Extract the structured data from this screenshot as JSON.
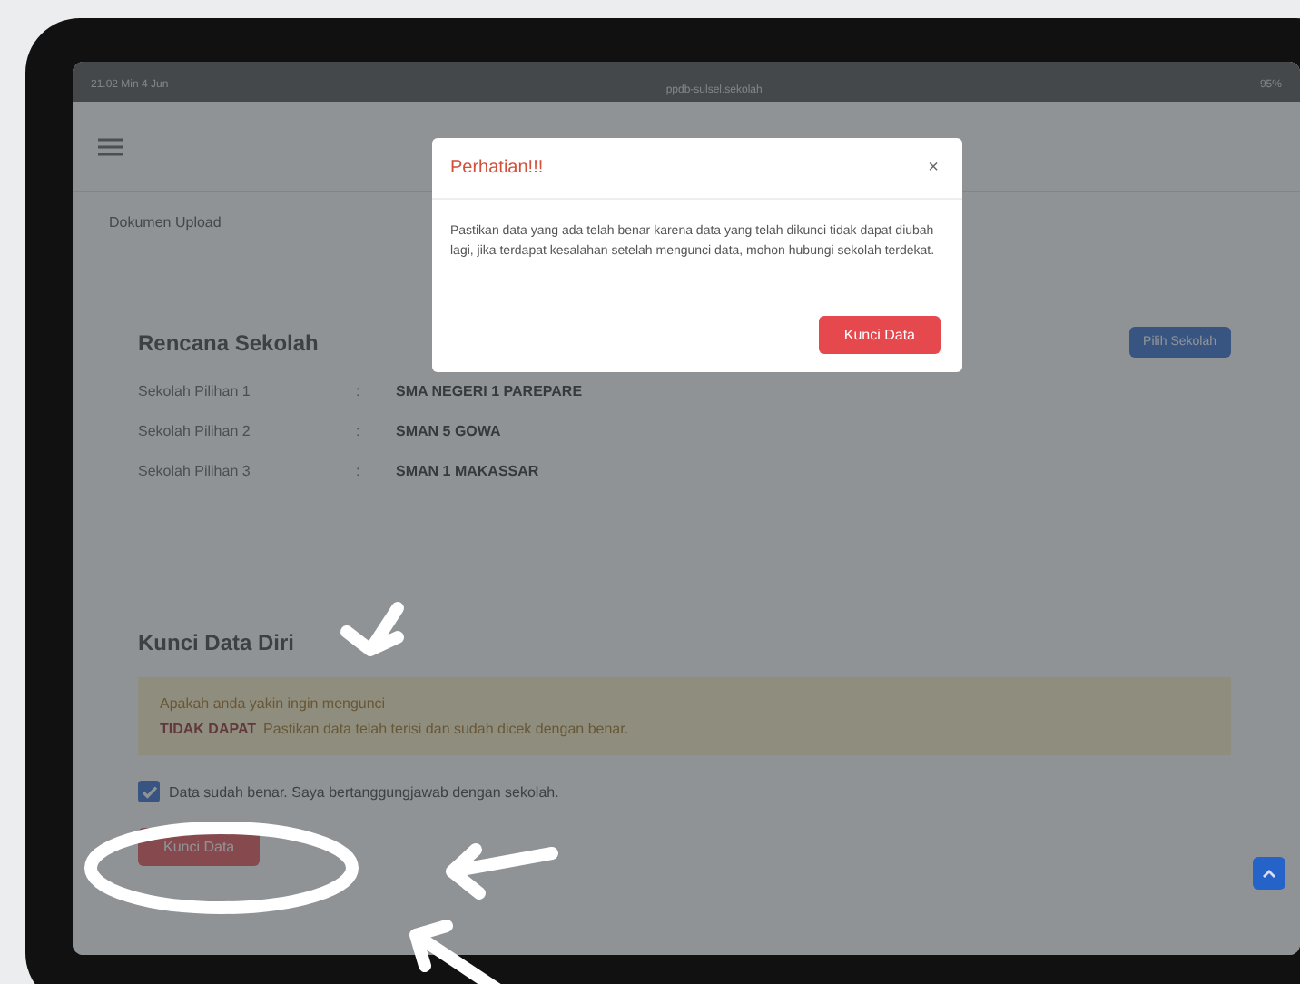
{
  "status_bar": {
    "time": "21.02",
    "date": "Min 4 Jun",
    "url": "ppdb-sulsel.sekolah",
    "battery": "95%"
  },
  "page": {
    "breadcrumb": "Dokumen Upload",
    "plan": {
      "title": "Rencana Sekolah",
      "button": "Pilih Sekolah",
      "rows": [
        {
          "label": "Sekolah Pilihan 1",
          "separator": ":",
          "value": "SMA NEGERI 1 PAREPARE"
        },
        {
          "label": "Sekolah Pilihan 2",
          "separator": ":",
          "value": "SMAN 5 GOWA"
        },
        {
          "label": "Sekolah Pilihan 3",
          "separator": ":",
          "value": "SMAN 1 MAKASSAR"
        }
      ]
    },
    "lock": {
      "title": "Kunci Data Diri",
      "alert_line_1": "Apakah anda yakin ingin mengunci",
      "alert_strong": "TIDAK DAPAT",
      "alert_line_2": "Pastikan data telah terisi dan sudah dicek dengan benar.",
      "checkbox": {
        "label": "Data sudah benar. Saya bertanggungjawab dengan sekolah.",
        "checked": true
      },
      "button": "Kunci Data"
    }
  },
  "modal": {
    "title": "Perhatian!!!",
    "close": "×",
    "body": "Pastikan data yang ada telah benar karena data yang telah dikunci tidak dapat diubah lagi, jika terdapat kesalahan setelah mengunci data, mohon hubungi sekolah terdekat.",
    "button": "Kunci Data"
  }
}
